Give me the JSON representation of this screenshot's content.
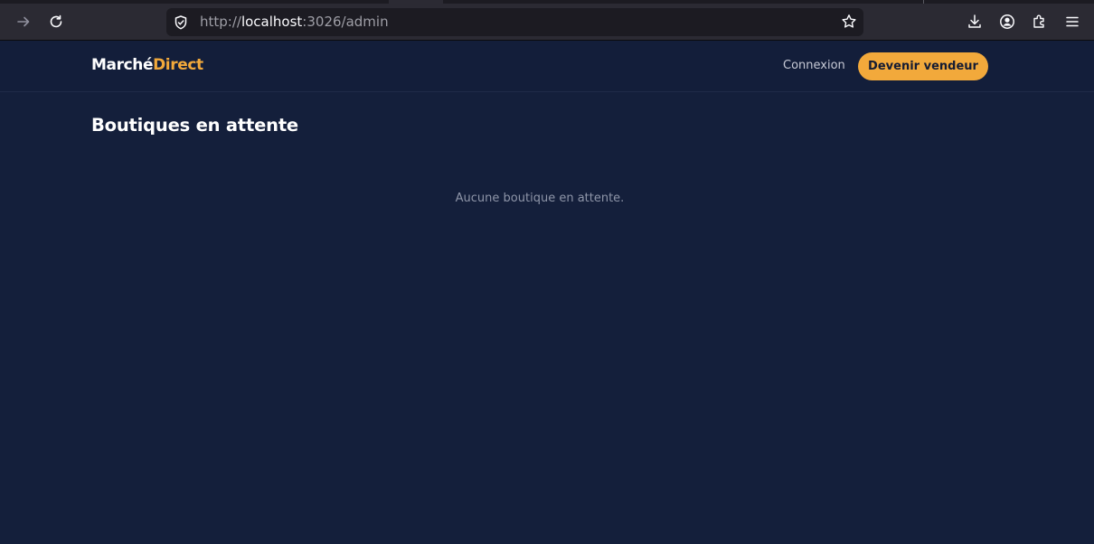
{
  "browser": {
    "url_prefix": "http://",
    "url_host": "localhost",
    "url_path": ":3026/admin",
    "icons": {
      "forward": "arrow-right",
      "reload": "reload",
      "site_info": "shield",
      "bookmark": "star",
      "downloads": "download",
      "account": "account",
      "extensions": "puzzle",
      "menu": "hamburger"
    }
  },
  "header": {
    "logo_part1": "Marché",
    "logo_part2": "Direct",
    "login_label": "Connexion",
    "cta_label": "Devenir vendeur"
  },
  "main": {
    "title": "Boutiques en attente",
    "empty_message": "Aucune boutique en attente."
  },
  "colors": {
    "page_bg": "#141f3b",
    "accent": "#f2a93b",
    "chrome_bg": "#2b2a33",
    "muted_text": "#8e95a8"
  }
}
